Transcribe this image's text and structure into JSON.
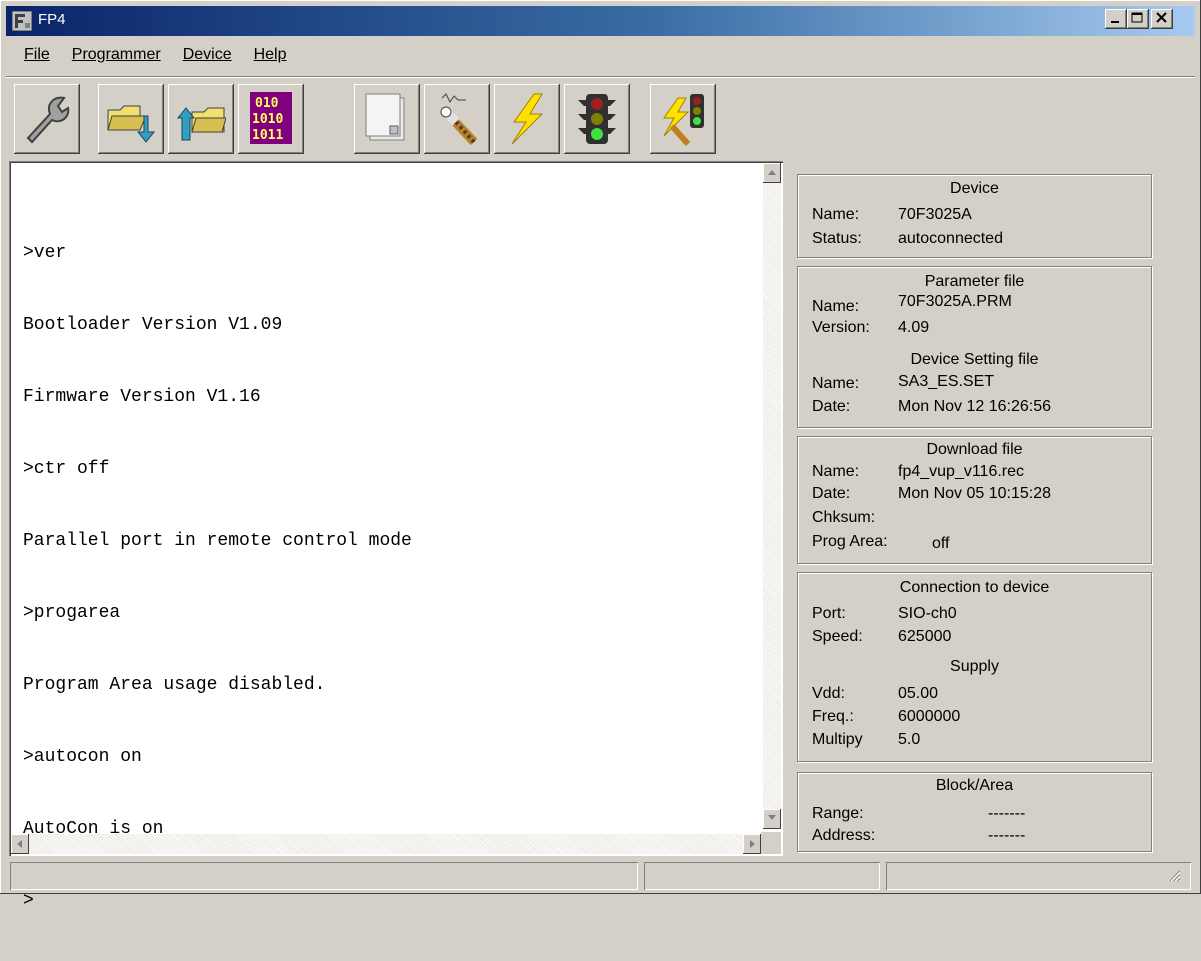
{
  "window": {
    "title": "FP4"
  },
  "menu": [
    "File",
    "Programmer",
    "Device",
    "Help"
  ],
  "toolbar": [
    "settings-wrench-icon",
    "open-folder-download-icon",
    "open-folder-upload-icon",
    "binary-file-icon",
    "blank-page-icon",
    "signal-probe-icon",
    "lightning-icon",
    "traffic-light-icon",
    "lightning-traffic-light-icon"
  ],
  "console": {
    "lines": [
      ">ver",
      "Bootloader Version V1.09",
      "Firmware Version V1.16",
      ">ctr off",
      "Parallel port in remote control mode",
      ">progarea",
      "Program Area usage disabled.",
      ">autocon on",
      "AutoCon is on",
      ">"
    ]
  },
  "device": {
    "title": "Device",
    "name_label": "Name:",
    "name": "70F3025A",
    "status_label": "Status:",
    "status": "autoconnected"
  },
  "param": {
    "title": "Parameter file",
    "name_label": "Name:",
    "name": "70F3025A.PRM",
    "version_label": "Version:",
    "version": "4.09",
    "setting_title": "Device Setting file",
    "setting_name_label": "Name:",
    "setting_name": "SA3_ES.SET",
    "date_label": "Date:",
    "date": "Mon Nov 12 16:26:56"
  },
  "download": {
    "title": "Download file",
    "name_label": "Name:",
    "name": "fp4_vup_v116.rec",
    "date_label": "Date:",
    "date": "Mon Nov 05 10:15:28",
    "chksum_label": "Chksum:",
    "chksum": "",
    "progarea_label": "Prog Area:",
    "progarea": "off"
  },
  "connection": {
    "title": "Connection to device",
    "port_label": "Port:",
    "port": "SIO-ch0",
    "speed_label": "Speed:",
    "speed": "625000",
    "supply_title": "Supply",
    "vdd_label": "Vdd:",
    "vdd": "05.00",
    "freq_label": "Freq.:",
    "freq": "6000000",
    "mult_label": "Multipy",
    "mult": "5.0"
  },
  "block": {
    "title": "Block/Area",
    "range_label": "Range:",
    "range": "-------",
    "address_label": "Address:",
    "address": "-------"
  }
}
